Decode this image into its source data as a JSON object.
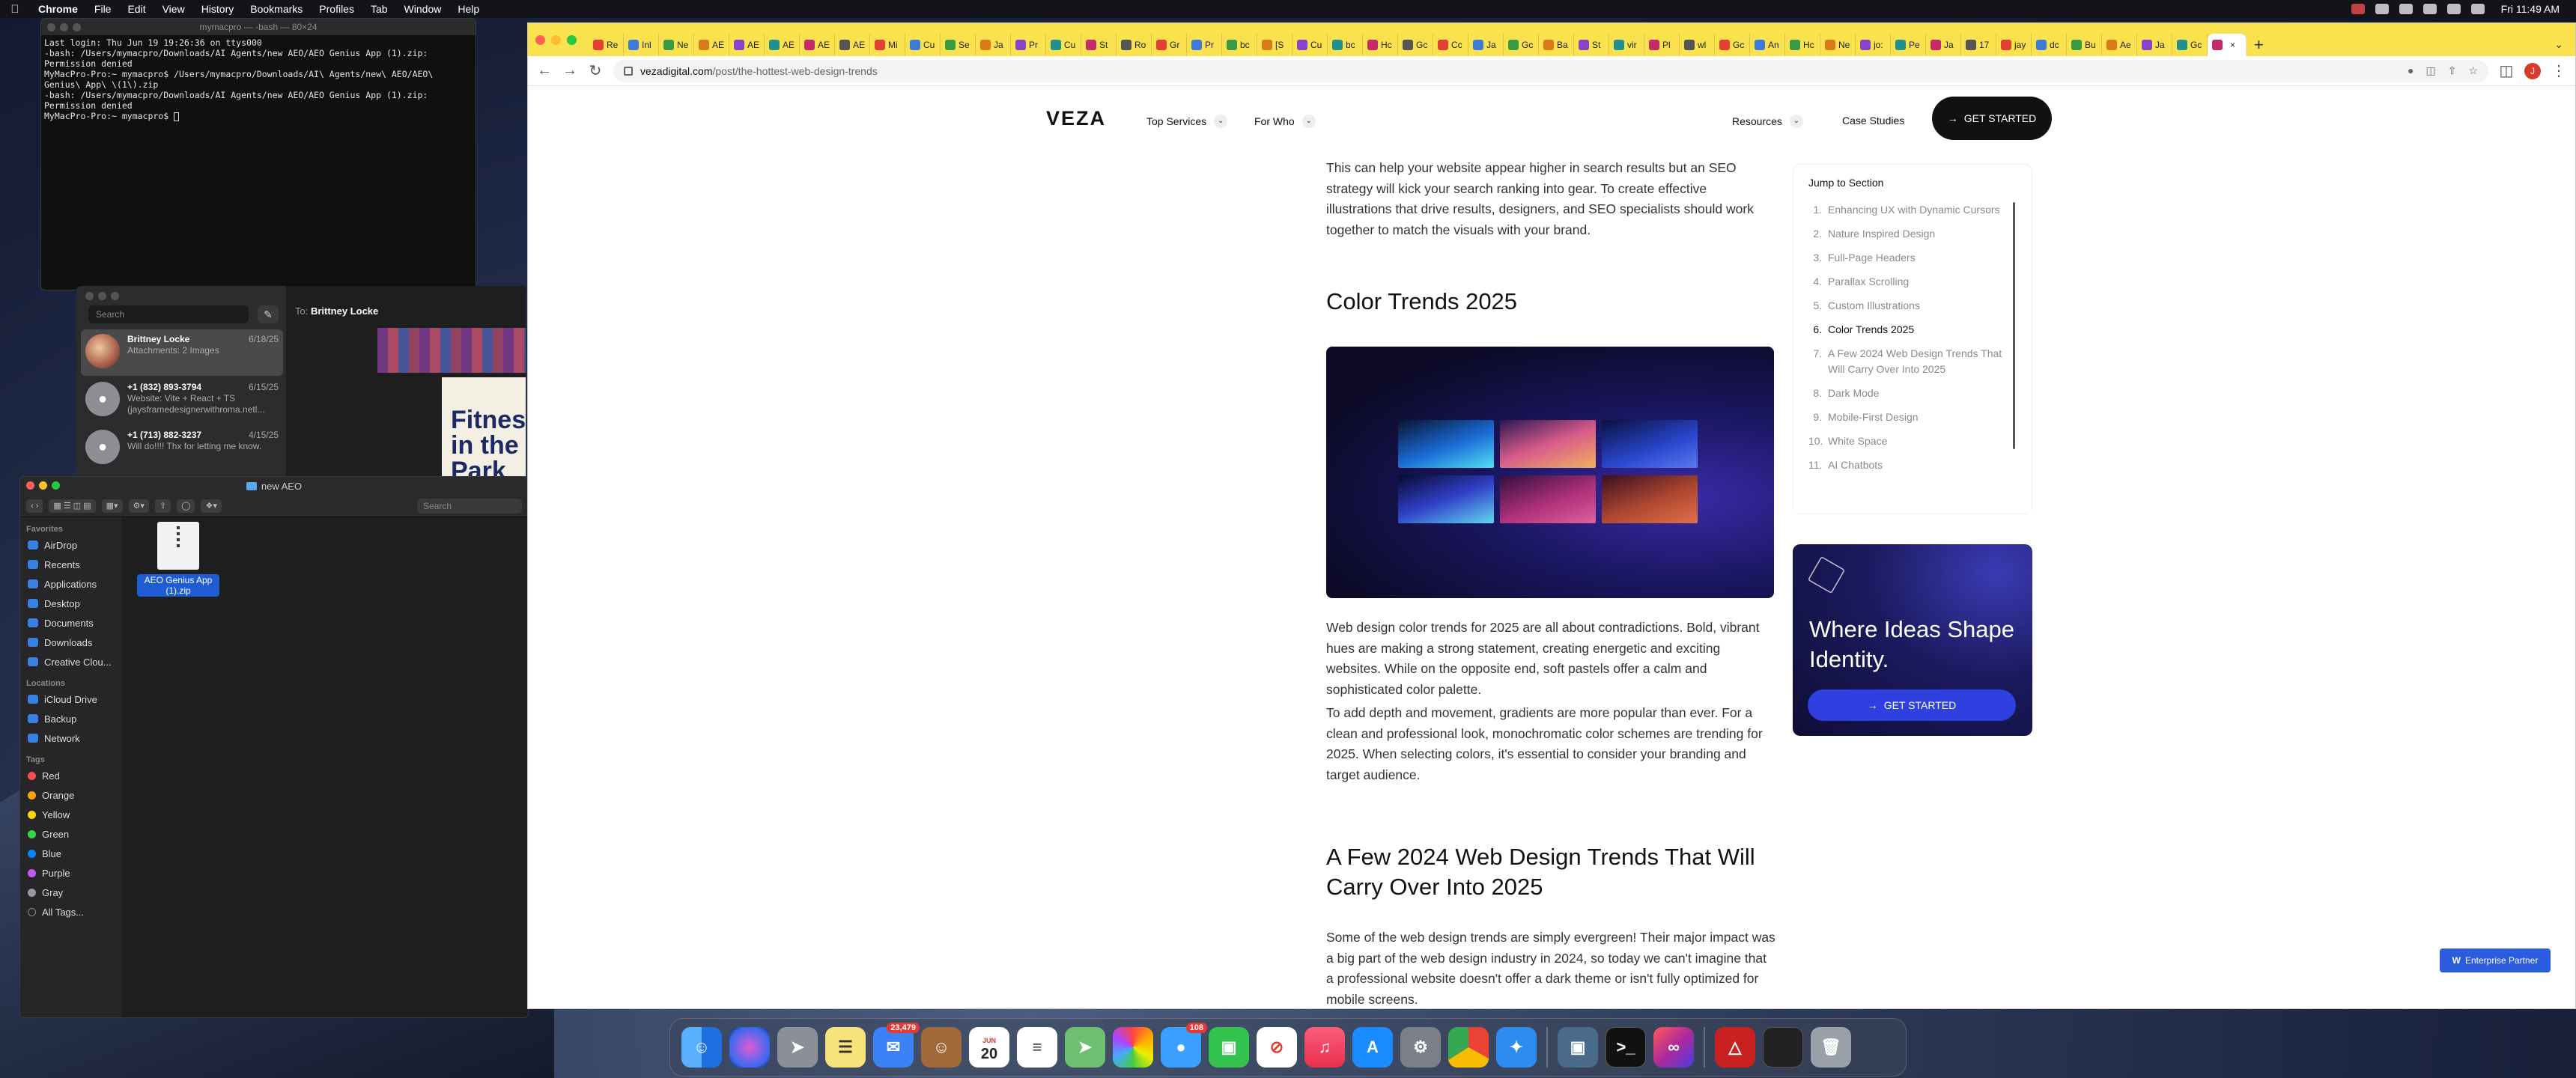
{
  "menubar": {
    "app": "Chrome",
    "items": [
      "File",
      "Edit",
      "View",
      "History",
      "Bookmarks",
      "Profiles",
      "Tab",
      "Window",
      "Help"
    ],
    "clock": "Fri 11:49 AM"
  },
  "terminal": {
    "title": "mymacpro — -bash — 80×24",
    "lines": [
      "Last login: Thu Jun 19 19:26:36 on ttys000",
      "-bash: /Users/mymacpro/Downloads/AI Agents/new AEO/AEO Genius App (1).zip: Permission denied",
      "MyMacPro-Pro:~ mymacpro$ /Users/mymacpro/Downloads/AI\\ Agents/new\\ AEO/AEO\\ Genius\\ App\\ \\(1\\).zip",
      "-bash: /Users/mymacpro/Downloads/AI Agents/new AEO/AEO Genius App (1).zip: Permission denied",
      "MyMacPro-Pro:~ mymacpro$"
    ]
  },
  "messages": {
    "search_placeholder": "Search",
    "to_label": "To:",
    "to_name": "Brittney Locke",
    "conversations": [
      {
        "name": "Brittney Locke",
        "date": "6/18/25",
        "preview": "Attachments: 2 Images"
      },
      {
        "name": "+1 (832) 893-3794",
        "date": "6/15/25",
        "preview": "Website: Vite + React + TS (jaysframedesignerwithroma.netl..."
      },
      {
        "name": "+1 (713) 882-3237",
        "date": "4/15/25",
        "preview": "Will do!!!! Thx for letting me know."
      }
    ],
    "poster_text": "Fitnes in the Park"
  },
  "finder": {
    "title": "new AEO",
    "search_placeholder": "Search",
    "favorites_header": "Favorites",
    "favorites": [
      "AirDrop",
      "Recents",
      "Applications",
      "Desktop",
      "Documents",
      "Downloads",
      "Creative Clou..."
    ],
    "locations_header": "Locations",
    "locations": [
      "iCloud Drive",
      "Backup",
      "Network"
    ],
    "tags_header": "Tags",
    "tags": [
      {
        "name": "Red",
        "color": "#ff4d4d"
      },
      {
        "name": "Orange",
        "color": "#ff9f0a"
      },
      {
        "name": "Yellow",
        "color": "#ffd60a"
      },
      {
        "name": "Green",
        "color": "#32d74b"
      },
      {
        "name": "Blue",
        "color": "#0a84ff"
      },
      {
        "name": "Purple",
        "color": "#bf5af2"
      },
      {
        "name": "Gray",
        "color": "#98989d"
      }
    ],
    "all_tags": "All Tags...",
    "file_name": "AEO Genius App (1).zip"
  },
  "browser": {
    "tab_labels": [
      "Re",
      "Inl",
      "Ne",
      "AE",
      "AE",
      "AE",
      "AE",
      "AE",
      "Mi",
      "Cu",
      "Se",
      "Ja",
      "Pr",
      "Cu",
      "St",
      "Ro",
      "Gr",
      "Pr",
      "bc",
      "[S",
      "Cu",
      "bc",
      "Hc",
      "Gc",
      "Cc",
      "Ja",
      "Gc",
      "Ba",
      "St",
      "vir",
      "Pl",
      "wl",
      "Gc",
      "An",
      "Hc",
      "Ne",
      "jo:",
      "Pe",
      "Ja",
      "17",
      "jay",
      "dc",
      "Bu",
      "Ae",
      "Ja",
      "Gc",
      ""
    ],
    "url_host": "vezadigital.com",
    "url_path": "/post/the-hottest-web-design-trends",
    "profile_initial": "J"
  },
  "site": {
    "logo": "VEZA",
    "nav": {
      "services": "Top Services",
      "for_who": "For Who",
      "resources": "Resources",
      "case_studies": "Case Studies"
    },
    "cta": "GET STARTED",
    "article": {
      "intro": "This can help your website appear higher in search results but an SEO strategy will kick your search ranking into gear. To create effective illustrations that drive results, designers, and SEO specialists should work together to match the visuals with your brand.",
      "h_color": "Color Trends 2025",
      "p_color_1": "Web design color trends for 2025 are all about contradictions. Bold, vibrant hues are making a strong statement, creating energetic and exciting websites. While on the opposite end, soft pastels offer a calm and sophisticated color palette.",
      "p_color_2": "To add depth and movement, gradients are more popular than ever. For a clean and professional look, monochromatic color schemes are trending for 2025. When selecting colors, it's essential to consider your branding and target audience.",
      "h_carry": "A Few 2024 Web Design Trends That Will Carry Over Into 2025",
      "p_carry": "Some of the web design trends are simply evergreen! Their major impact was a big part of the web design industry in 2024, so today we can't imagine that a professional website doesn't offer a dark theme or isn't fully optimized for mobile screens."
    },
    "toc": {
      "title": "Jump to Section",
      "items": [
        {
          "n": "1.",
          "t": "Enhancing UX with Dynamic Cursors"
        },
        {
          "n": "2.",
          "t": "Nature Inspired Design"
        },
        {
          "n": "3.",
          "t": "Full-Page Headers"
        },
        {
          "n": "4.",
          "t": "Parallax Scrolling"
        },
        {
          "n": "5.",
          "t": "Custom Illustrations"
        },
        {
          "n": "6.",
          "t": "Color Trends 2025"
        },
        {
          "n": "7.",
          "t": "A Few 2024 Web Design Trends That Will Carry Over Into 2025"
        },
        {
          "n": "8.",
          "t": "Dark Mode"
        },
        {
          "n": "9.",
          "t": "Mobile-First Design"
        },
        {
          "n": "10.",
          "t": "White Space"
        },
        {
          "n": "11.",
          "t": "AI Chatbots"
        }
      ]
    },
    "promo": {
      "title": "Where Ideas Shape Identity.",
      "button": "GET STARTED"
    },
    "badge": "Enterprise Partner"
  },
  "dock": {
    "mail_badge": "23,479",
    "messages_badge": "108",
    "calendar_day": "20",
    "calendar_month": "JUN"
  }
}
